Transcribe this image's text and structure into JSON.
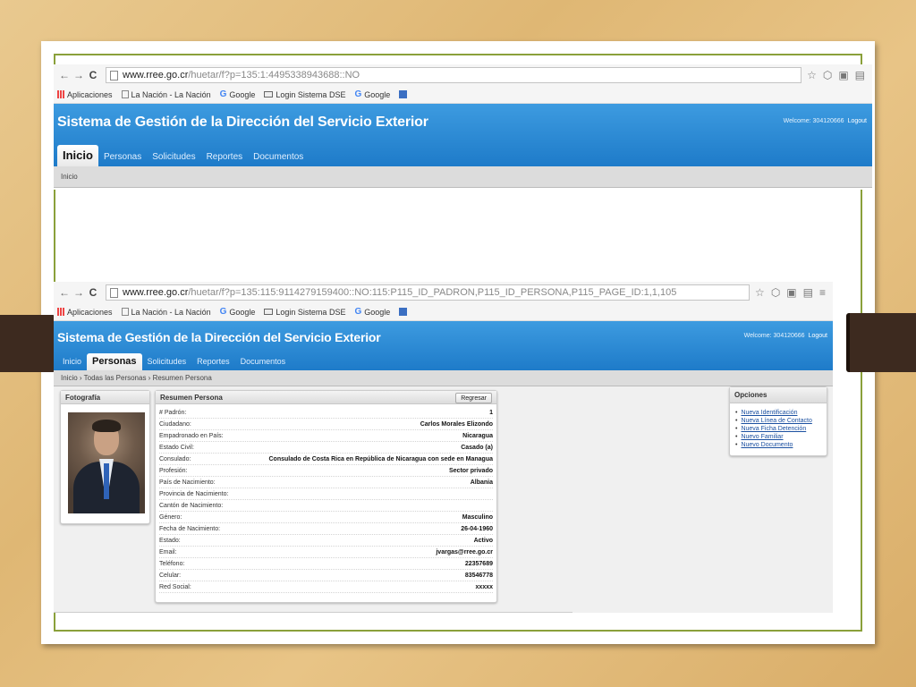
{
  "top_browser": {
    "url_host": "www.rree.go.cr",
    "url_path": "/huetar/f?p=135:1:4495338943688::NO",
    "bookmarks": [
      "Aplicaciones",
      "La Nación - La Nación",
      "Google",
      "Login Sistema DSE",
      "Google"
    ],
    "app_title": "Sistema de Gestión de la Dirección del Servicio Exterior",
    "welcome": "Welcome: 304120666",
    "logout": "Logout",
    "tabs": [
      "Inicio",
      "Personas",
      "Solicitudes",
      "Reportes",
      "Documentos"
    ],
    "active_tab": "Inicio",
    "breadcrumb": "Inicio"
  },
  "bottom_browser": {
    "url_host": "www.rree.go.cr",
    "url_path": "/huetar/f?p=135:115:9114279159400::NO:115:P115_ID_PADRON,P115_ID_PERSONA,P115_PAGE_ID:1,1,105",
    "bookmarks": [
      "Aplicaciones",
      "La Nación - La Nación",
      "Google",
      "Login Sistema DSE",
      "Google"
    ],
    "app_title": "Sistema de Gestión de la Dirección del Servicio Exterior",
    "welcome": "Welcome: 304120666",
    "logout": "Logout",
    "tabs": [
      "Inicio",
      "Personas",
      "Solicitudes",
      "Reportes",
      "Documentos"
    ],
    "active_tab": "Personas",
    "breadcrumb": "Inicio › Todas las Personas › Resumen Persona"
  },
  "photo_panel": {
    "title": "Fotografía"
  },
  "summary": {
    "title": "Resumen Persona",
    "back_button": "Regresar",
    "rows": [
      {
        "label": "# Padrón:",
        "value": "1"
      },
      {
        "label": "Ciudadano:",
        "value": "Carlos Morales Elizondo"
      },
      {
        "label": "Empadronado en País:",
        "value": "Nicaragua"
      },
      {
        "label": "Estado Civil:",
        "value": "Casado (a)"
      },
      {
        "label": "Consulado:",
        "value": "Consulado de Costa Rica en República de Nicaragua con sede en Managua"
      },
      {
        "label": "Profesión:",
        "value": "Sector privado"
      },
      {
        "label": "País de Nacimiento:",
        "value": "Albania"
      },
      {
        "label": "Provincia de Nacimiento:",
        "value": ""
      },
      {
        "label": "Cantón de Nacimiento:",
        "value": ""
      },
      {
        "label": "Género:",
        "value": "Masculino"
      },
      {
        "label": "Fecha de Nacimiento:",
        "value": "26-04-1960"
      },
      {
        "label": "Estado:",
        "value": "Activo"
      },
      {
        "label": "Email:",
        "value": "jvargas@rree.go.cr"
      },
      {
        "label": "Teléfono:",
        "value": "22357689"
      },
      {
        "label": "Celular:",
        "value": "83546778"
      },
      {
        "label": "Red Social:",
        "value": "xxxxx"
      }
    ]
  },
  "options": {
    "title": "Opciones",
    "items": [
      "Nueva Identificación",
      "Nueva Línea de Contacto",
      "Nueva Ficha Detención",
      "Nuevo Familiar",
      "Nuevo Documento"
    ]
  }
}
